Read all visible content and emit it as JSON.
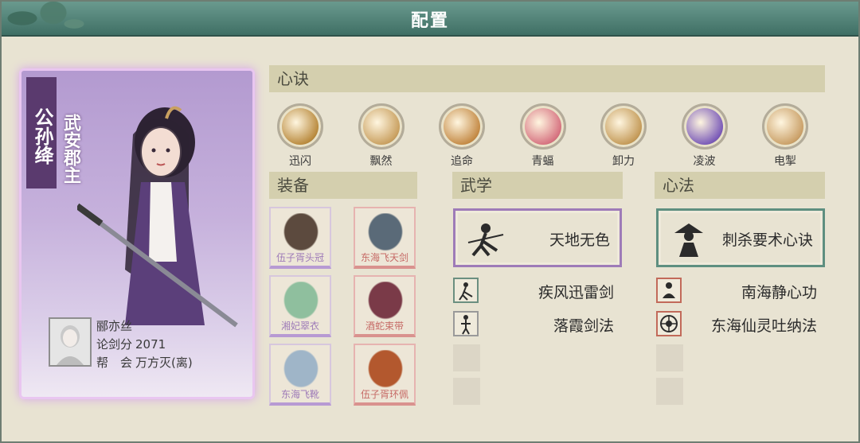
{
  "window": {
    "title": "配置"
  },
  "character": {
    "name": "公孙绛",
    "title": "武安郡主",
    "player": {
      "name": "郦亦丝",
      "score_label": "论剑分",
      "score": "2071",
      "guild_label": "帮　会",
      "guild": "万方灭(离)"
    }
  },
  "sections": {
    "xinjue": "心诀",
    "equip": "装备",
    "wuxue": "武学",
    "xinfa": "心法"
  },
  "skills": [
    {
      "label": "迅闪",
      "color": "#b98a3d",
      "icon": "dash-icon"
    },
    {
      "label": "飘然",
      "color": "#c9a060",
      "icon": "swirl-icon"
    },
    {
      "label": "追命",
      "color": "#c48a45",
      "icon": "chase-icon"
    },
    {
      "label": "青蝠",
      "color": "#d67280",
      "icon": "bat-icon"
    },
    {
      "label": "卸力",
      "color": "#c49a58",
      "icon": "deflect-icon"
    },
    {
      "label": "凌波",
      "color": "#7a5ab8",
      "icon": "wave-icon"
    },
    {
      "label": "电掣",
      "color": "#caa068",
      "icon": "lightning-icon"
    }
  ],
  "equipment": [
    {
      "label": "伍子胥头冠",
      "color": "#5c4a3e",
      "rarity": "purple",
      "icon": "crown-icon"
    },
    {
      "label": "东海飞天剑",
      "color": "#5a6a78",
      "rarity": "red",
      "icon": "sword-icon"
    },
    {
      "label": "湘妃翠衣",
      "color": "#8fbf9e",
      "rarity": "purple",
      "icon": "robe-icon"
    },
    {
      "label": "酒蛇束带",
      "color": "#7a3a48",
      "rarity": "red",
      "icon": "belt-icon"
    },
    {
      "label": "东海飞靴",
      "color": "#9fb5c8",
      "rarity": "purple",
      "icon": "boots-icon"
    },
    {
      "label": "伍子胥环佩",
      "color": "#b3582e",
      "rarity": "red",
      "icon": "pendant-icon"
    }
  ],
  "wuxue": {
    "main": "天地无色",
    "subs": [
      "疾风迅雷剑",
      "落霞剑法"
    ]
  },
  "xinfa": {
    "main": "刺杀要术心诀",
    "subs": [
      "南海静心功",
      "东海仙灵吐纳法"
    ]
  }
}
